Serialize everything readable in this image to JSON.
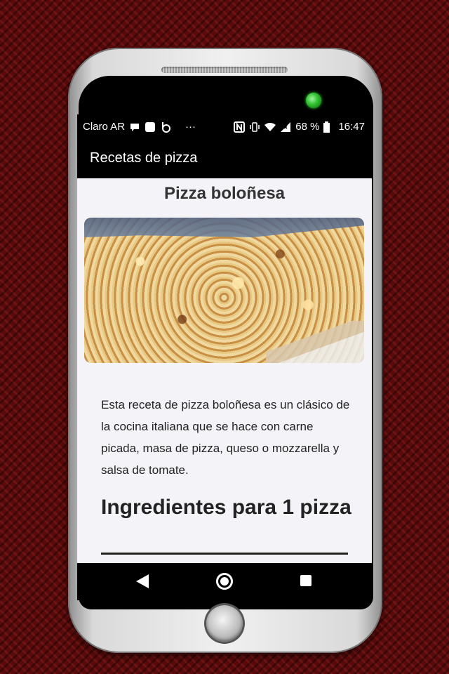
{
  "status_bar": {
    "carrier": "Claro AR",
    "dots": "···",
    "battery": "68 %",
    "time": "16:47",
    "icons": [
      "chat-bubble-icon",
      "notification-square-icon",
      "beats-icon",
      "nfc-icon",
      "vibrate-icon",
      "wifi-icon",
      "signal-icon",
      "battery-icon"
    ]
  },
  "app_bar": {
    "title": "Recetas de pizza"
  },
  "recipe": {
    "title": "Pizza boloñesa",
    "description": "Esta receta de pizza boloñesa es un clásico de la cocina italiana que se hace con carne picada, masa de pizza, queso o mozzarella y salsa de tomate.",
    "section_heading": "Ingredientes para 1 pizza"
  },
  "nav_bar": {
    "icons": [
      "back-icon",
      "home-icon",
      "recent-apps-icon"
    ]
  }
}
